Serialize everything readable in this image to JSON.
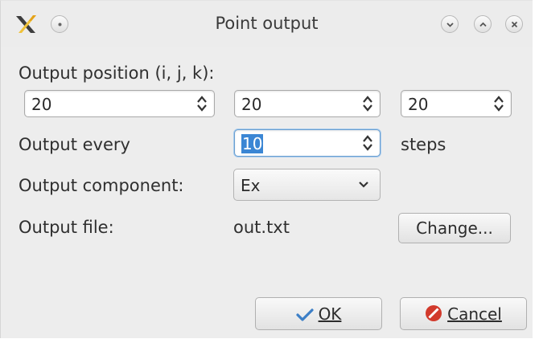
{
  "window": {
    "title": "Point output"
  },
  "titlebar": {
    "icons": [
      "app-icon",
      "menu-dot-icon",
      "minimize-icon",
      "maximize-icon",
      "close-icon"
    ]
  },
  "form": {
    "position_label": "Output position (i, j, k):",
    "position_i": "20",
    "position_j": "20",
    "position_k": "20",
    "every_label": "Output every",
    "every_value": "10",
    "every_unit": "steps",
    "component_label": "Output component:",
    "component_value": "Ex",
    "file_label": "Output file:",
    "file_value": "out.txt",
    "change_label": "Change..."
  },
  "buttons": {
    "ok_label": "OK",
    "cancel_label": "Cancel"
  },
  "colors": {
    "selection": "#3b86d4",
    "ok_check": "#3c7fc7",
    "cancel_icon": "#d23a2c"
  }
}
